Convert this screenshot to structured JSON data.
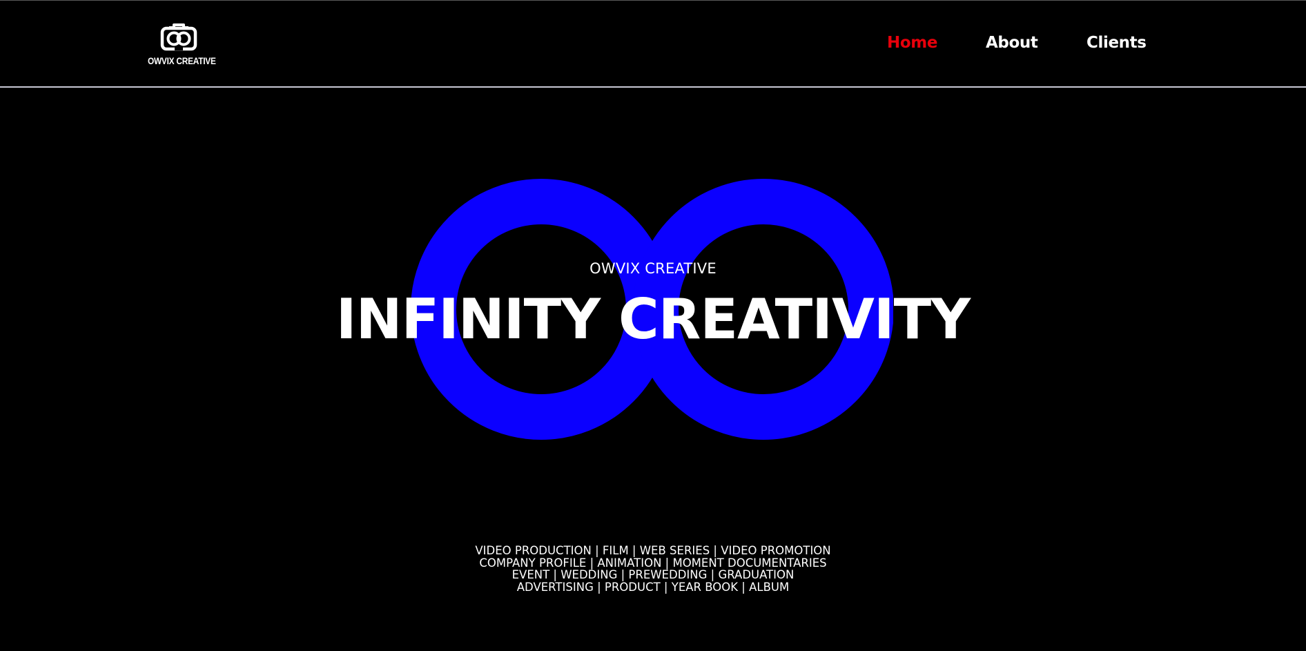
{
  "header": {
    "logo": {
      "icon": "camera-infinity-logo-icon",
      "text": "OWVIX CREATIVE"
    },
    "nav": [
      {
        "label": "Home",
        "active": true,
        "color": "#e8000b"
      },
      {
        "label": "About",
        "active": false,
        "color": "#ffffff"
      },
      {
        "label": "Clients",
        "active": false,
        "color": "#ffffff"
      }
    ]
  },
  "hero": {
    "graphic": "infinity-symbol-icon",
    "graphic_color": "#0b00ff",
    "subtitle": "OWVIX CREATIVE",
    "title": "INFINITY CREATIVITY"
  },
  "services": [
    "VIDEO PRODUCTION | FILM | WEB SERIES | VIDEO PROMOTION",
    "COMPANY PROFILE | ANIMATION | MOMENT DOCUMENTARIES",
    "EVENT | WEDDING | PREWEDDING | GRADUATION",
    "ADVERTISING | PRODUCT | YEAR BOOK | ALBUM"
  ],
  "colors": {
    "background": "#000000",
    "text": "#ffffff",
    "accent": "#e8000b",
    "divider": "#c9c9d6"
  }
}
